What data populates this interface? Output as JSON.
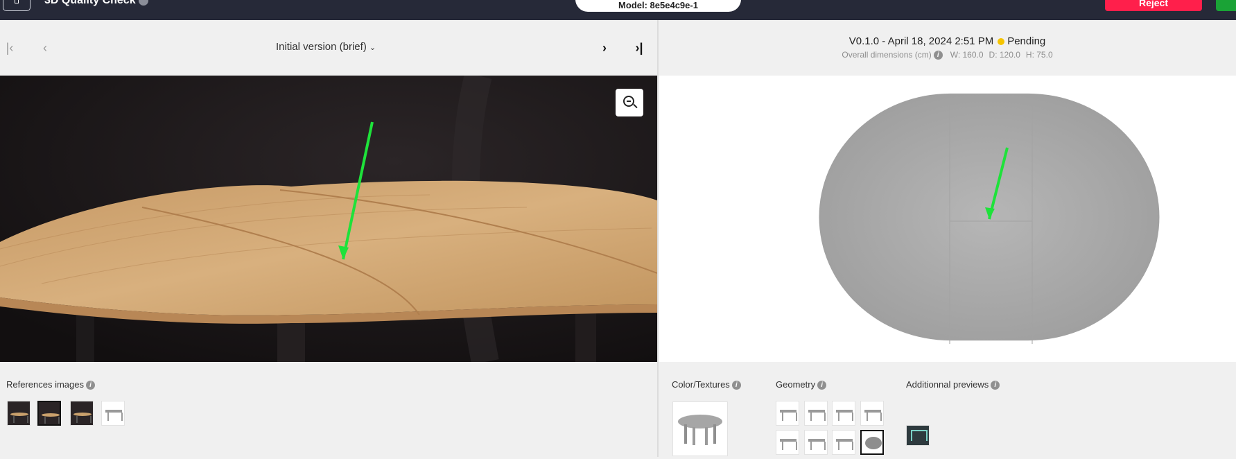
{
  "header": {
    "app_title": "3D Quality Check",
    "model_label": "Model: 8e5e4c9e-1",
    "reject_label": "Reject"
  },
  "left": {
    "version_select": "Initial version (brief)",
    "nav": {
      "first": "|‹",
      "prev": "‹",
      "next": "›",
      "last": "›|"
    },
    "references_label": "References images"
  },
  "right": {
    "version": "V0.1.0 - April 18, 2024 2:51 PM",
    "status": "Pending",
    "dims_label": "Overall dimensions (cm)",
    "width": "W: 160.0",
    "depth": "D: 120.0",
    "height": "H: 75.0",
    "color_textures_label": "Color/Textures",
    "geometry_label": "Geometry",
    "additional_previews_label": "Additionnal previews"
  },
  "icons": {
    "info": "i",
    "annotation_arrow_color": "#1ee23a"
  },
  "colors": {
    "topbar": "#262938",
    "reject": "#ff1f4b",
    "approve": "#1aa336",
    "pending": "#f5c400"
  }
}
